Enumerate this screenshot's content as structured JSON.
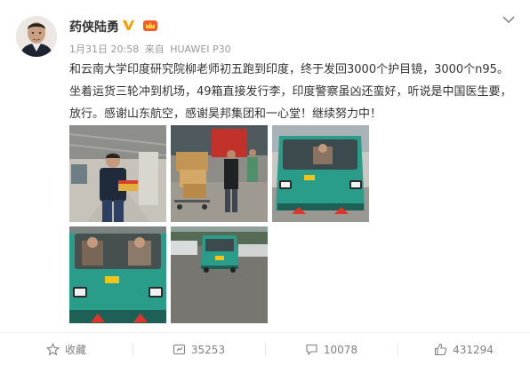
{
  "post": {
    "author": "药侠陆勇",
    "date": "1月31日 20:58",
    "from_label": "来自",
    "device": "HUAWEI P30",
    "text": "和云南大学印度研究院柳老师初五跑到印度，终于发回3000个护目镜，3000个n95。坐着运货三轮冲到机场，49箱直接发行李，印度警察虽凶还蛮好，听说是中国医生要，放行。感谢山东航空，感谢昊邦集团和一心堂！继续努力中！",
    "photo_count": 5
  },
  "toolbar": {
    "favorite_label": "收藏",
    "repost_count": "35253",
    "comment_count": "10078",
    "like_count": "431294"
  },
  "colors": {
    "verified_orange": "#f7a000",
    "text": "#333333",
    "meta": "#999999",
    "action": "#808080",
    "truck_teal": "#2a9c8a"
  }
}
